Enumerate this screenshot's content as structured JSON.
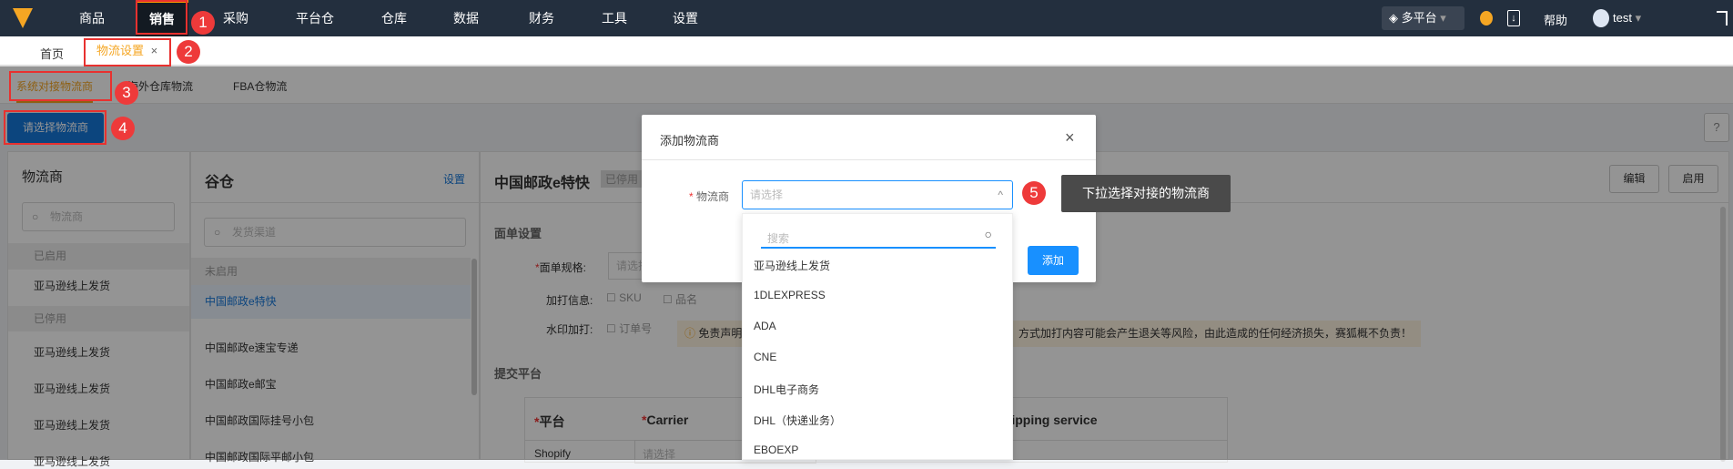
{
  "topnav": {
    "items": [
      "商品",
      "销售",
      "采购",
      "平台仓",
      "仓库",
      "数据",
      "财务",
      "工具",
      "设置"
    ],
    "active": "销售",
    "platform": "多平台",
    "help": "帮助",
    "user": "test"
  },
  "tabs": {
    "home": "首页",
    "active": "物流设置",
    "close": "×"
  },
  "subtabs": [
    "系统对接物流商",
    "海外仓库物流",
    "FBA仓物流"
  ],
  "toolbar": {
    "select_button": "请选择物流商",
    "help": "?"
  },
  "left_panel": {
    "title": "物流商",
    "search_placeholder": "物流商",
    "group_enabled": "已启用",
    "enabled_items": [
      "亚马逊线上发货"
    ],
    "group_disabled": "已停用",
    "disabled_items": [
      "亚马逊线上发货",
      "亚马逊线上发货",
      "亚马逊线上发货",
      "亚马逊线上发货"
    ]
  },
  "middle_panel": {
    "title": "谷仓",
    "settings_link": "设置",
    "search_placeholder": "发货渠道",
    "group": "未启用",
    "items": [
      "中国邮政e特快",
      "中国邮政e速宝专递",
      "中国邮政e邮宝",
      "中国邮政国际挂号小包",
      "中国邮政国际平邮小包"
    ]
  },
  "detail": {
    "title": "中国邮政e特快",
    "status": "已停用",
    "edit": "编辑",
    "enable": "启用",
    "section_label": "面单设置",
    "spec_label": "面单规格:",
    "spec_placeholder": "请选择",
    "extra_label": "加打信息:",
    "extra_opts": [
      "SKU",
      "品名"
    ],
    "watermark_label": "水印加打:",
    "watermark_opt": "订单号",
    "warning_prefix": "免责声明",
    "warning_suffix": "方式加打内容可能会产生退关等风险，由此造成的任何经济损失，赛狐概不负责！",
    "submit_section": "提交平台",
    "table_headers": [
      "平台",
      "Carrier",
      "Shipping service"
    ],
    "row_platform": "Shopify",
    "row_carrier_placeholder": "请选择"
  },
  "modal": {
    "title": "添加物流商",
    "field_label": "物流商",
    "select_placeholder": "请选择",
    "add": "添加",
    "close": "×"
  },
  "dropdown": {
    "search_placeholder": "搜索",
    "options": [
      "亚马逊线上发货",
      "1DLEXPRESS",
      "ADA",
      "CNE",
      "DHL电子商务",
      "DHL（快递业务）",
      "EBOEXP"
    ]
  },
  "annotations": {
    "steps": [
      "1",
      "2",
      "3",
      "4",
      "5"
    ],
    "tooltip": "下拉选择对接的物流商"
  },
  "colors": {
    "nav": "#232f3e",
    "accent": "#f90",
    "primary": "#1890ff",
    "badge": "#ee3a3a"
  }
}
